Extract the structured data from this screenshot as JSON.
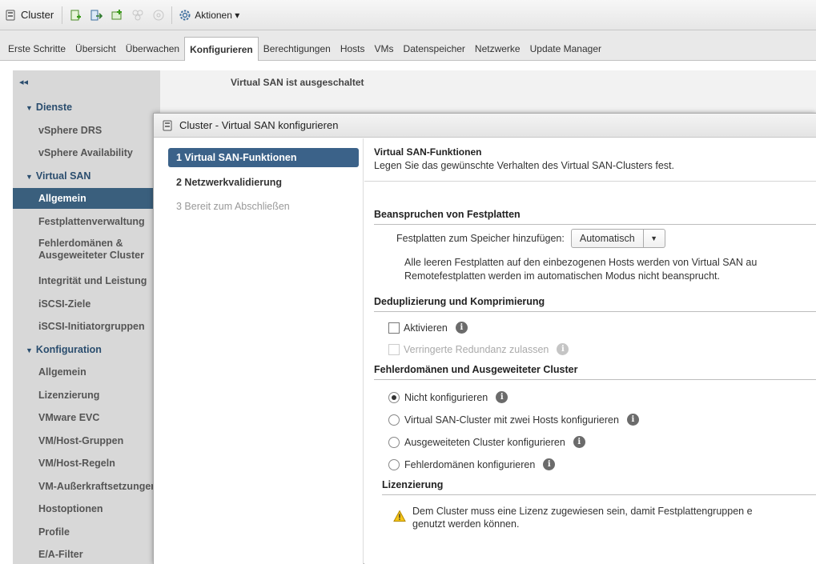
{
  "toolbar": {
    "title": "Cluster",
    "actions_label": "Aktionen ▾"
  },
  "tabs": [
    "Erste Schritte",
    "Übersicht",
    "Überwachen",
    "Konfigurieren",
    "Berechtigungen",
    "Hosts",
    "VMs",
    "Datenspeicher",
    "Netzwerke",
    "Update Manager"
  ],
  "active_tab": "Konfigurieren",
  "sidebar": {
    "collapse_label": "◂◂",
    "items": [
      {
        "label": "Dienste",
        "type": "group"
      },
      {
        "label": "vSphere DRS",
        "type": "item"
      },
      {
        "label": "vSphere Availability",
        "type": "item"
      },
      {
        "label": "Virtual SAN",
        "type": "group"
      },
      {
        "label": "Allgemein",
        "type": "selected"
      },
      {
        "label": "Festplattenverwaltung",
        "type": "item"
      },
      {
        "label": "Fehlerdomänen & Ausgeweiteter Cluster",
        "type": "multi"
      },
      {
        "label": "Integrität und Leistung",
        "type": "item"
      },
      {
        "label": "iSCSI-Ziele",
        "type": "item"
      },
      {
        "label": "iSCSI-Initiatorgruppen",
        "type": "item"
      },
      {
        "label": "Konfiguration",
        "type": "group"
      },
      {
        "label": "Allgemein",
        "type": "item"
      },
      {
        "label": "Lizenzierung",
        "type": "item"
      },
      {
        "label": "VMware EVC",
        "type": "item"
      },
      {
        "label": "VM/Host-Gruppen",
        "type": "item"
      },
      {
        "label": "VM/Host-Regeln",
        "type": "item"
      },
      {
        "label": "VM-Außerkraftsetzungen",
        "type": "item"
      },
      {
        "label": "Hostoptionen",
        "type": "item"
      },
      {
        "label": "Profile",
        "type": "item"
      },
      {
        "label": "E/A-Filter",
        "type": "item"
      }
    ]
  },
  "main": {
    "status": "Virtual SAN ist ausgeschaltet"
  },
  "dialog": {
    "title": "Cluster - Virtual SAN konfigurieren",
    "steps": [
      {
        "label": "1  Virtual SAN-Funktionen",
        "state": "current"
      },
      {
        "label": "2  Netzwerkvalidierung",
        "state": "normal"
      },
      {
        "label": "3  Bereit zum Abschließen",
        "state": "disabled"
      }
    ],
    "heading": "Virtual SAN-Funktionen",
    "subheading": "Legen Sie das gewünschte Verhalten des Virtual SAN-Clusters fest.",
    "claim": {
      "section": "Beanspruchen von Festplatten",
      "field_label": "Festplatten zum Speicher hinzufügen:",
      "field_value": "Automatisch",
      "desc_line1": "Alle leeren Festplatten auf den einbezogenen Hosts werden von Virtual SAN au",
      "desc_line2": "Remotefestplatten werden im automatischen Modus nicht beansprucht."
    },
    "dedup": {
      "section": "Deduplizierung und Komprimierung",
      "enable_label": "Aktivieren",
      "reduced_label": "Verringerte Redundanz zulassen"
    },
    "fault": {
      "section": "Fehlerdomänen und Ausgeweiteter Cluster",
      "options": [
        "Nicht konfigurieren",
        "Virtual SAN-Cluster mit zwei Hosts konfigurieren",
        "Ausgeweiteten Cluster konfigurieren",
        "Fehlerdomänen konfigurieren"
      ],
      "selected": "Nicht konfigurieren"
    },
    "licensing": {
      "section": "Lizenzierung",
      "warn_line1": "Dem Cluster muss eine Lizenz zugewiesen sein, damit Festplattengruppen e",
      "warn_line2": "genutzt werden können."
    }
  },
  "colors": {
    "selected_nav": "#3a5f7d",
    "current_step": "#3b6289",
    "group_text": "#2a4d6e"
  }
}
